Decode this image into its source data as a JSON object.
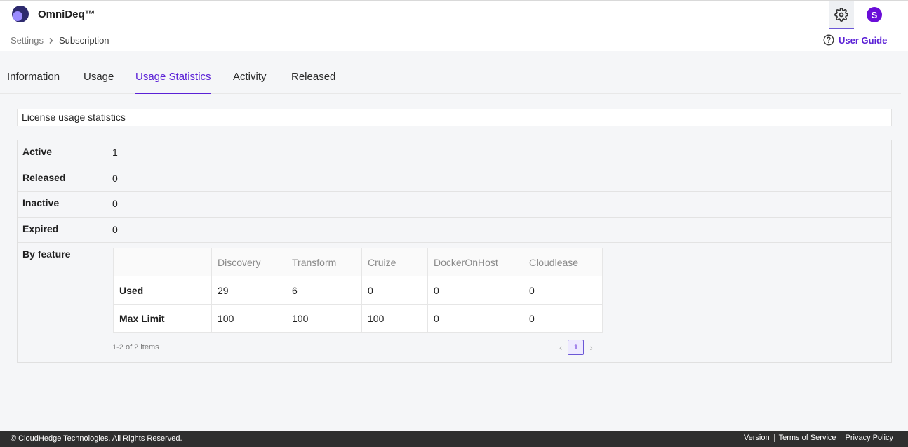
{
  "app": {
    "brand": "OmniDeq™"
  },
  "header": {
    "settings_icon": "gear-icon",
    "avatar_letter": "S"
  },
  "breadcrumb": {
    "items": [
      "Settings",
      "Subscription"
    ]
  },
  "user_guide": {
    "label": "User Guide",
    "icon": "help-circle-icon"
  },
  "tabs": [
    {
      "label": "Information"
    },
    {
      "label": "Usage"
    },
    {
      "label": "Usage Statistics",
      "active": true
    },
    {
      "label": "Activity"
    },
    {
      "label": "Released"
    }
  ],
  "section": {
    "title": "License usage statistics"
  },
  "stats": {
    "rows": [
      {
        "label": "Active",
        "value": "1"
      },
      {
        "label": "Released",
        "value": "0"
      },
      {
        "label": "Inactive",
        "value": "0"
      },
      {
        "label": "Expired",
        "value": "0"
      }
    ],
    "by_feature_label": "By feature"
  },
  "feature_table": {
    "columns": [
      "Discovery",
      "Transform",
      "Cruize",
      "DockerOnHost",
      "Cloudlease"
    ],
    "rows": [
      {
        "label": "Used",
        "values": [
          "29",
          "6",
          "0",
          "0",
          "0"
        ]
      },
      {
        "label": "Max Limit",
        "values": [
          "100",
          "100",
          "100",
          "0",
          "0"
        ]
      }
    ],
    "count_text": "1-2 of 2 items",
    "page": "1"
  },
  "footer": {
    "copyright": "© CloudHedge Technologies. All Rights Reserved.",
    "links": [
      "Version",
      "Terms of Service",
      "Privacy Policy"
    ]
  },
  "colors": {
    "accent": "#5b21d6",
    "avatar": "#6a0dd8",
    "footer_bg": "#2f2f2f"
  }
}
